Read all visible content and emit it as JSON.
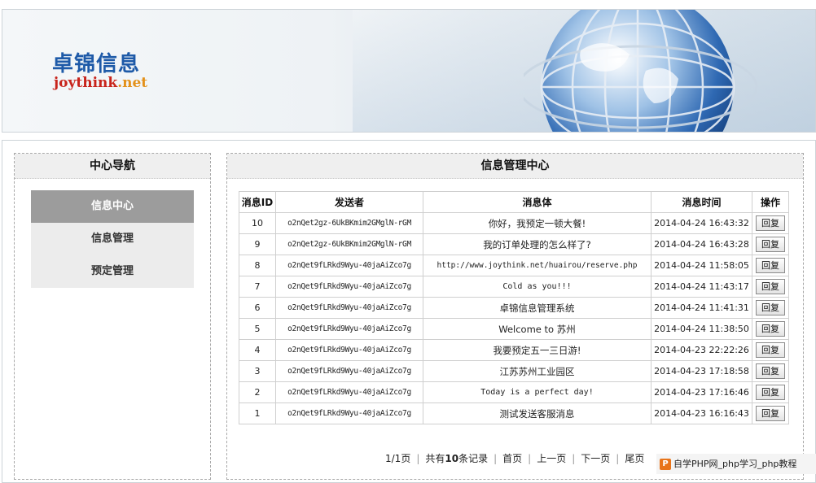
{
  "header": {
    "brand_cn": "卓锦信息",
    "brand_en_main": "joythink",
    "brand_en_tld": ".net"
  },
  "sidebar": {
    "title": "中心导航",
    "items": [
      {
        "label": "信息中心",
        "active": true
      },
      {
        "label": "信息管理",
        "active": false
      },
      {
        "label": "预定管理",
        "active": false
      }
    ]
  },
  "main": {
    "title": "信息管理中心",
    "columns": [
      "消息ID",
      "发送者",
      "消息体",
      "消息时间",
      "操作"
    ],
    "reply_label": "回复",
    "rows": [
      {
        "id": "10",
        "sender": "o2nQet2gz-6UkBKmim2GMglN-rGM",
        "body": "你好，我预定一顿大餐!",
        "time": "2014-04-24 16:43:32"
      },
      {
        "id": "9",
        "sender": "o2nQet2gz-6UkBKmim2GMglN-rGM",
        "body": "我的订单处理的怎么样了?",
        "time": "2014-04-24 16:43:28"
      },
      {
        "id": "8",
        "sender": "o2nQet9fLRkd9Wyu-40jaAiZco7g",
        "body": "http://www.joythink.net/huairou/reserve.php",
        "time": "2014-04-24 11:58:05"
      },
      {
        "id": "7",
        "sender": "o2nQet9fLRkd9Wyu-40jaAiZco7g",
        "body": "Cold as you!!!",
        "time": "2014-04-24 11:43:17"
      },
      {
        "id": "6",
        "sender": "o2nQet9fLRkd9Wyu-40jaAiZco7g",
        "body": "卓锦信息管理系统",
        "time": "2014-04-24 11:41:31"
      },
      {
        "id": "5",
        "sender": "o2nQet9fLRkd9Wyu-40jaAiZco7g",
        "body": "Welcome to 苏州",
        "time": "2014-04-24 11:38:50"
      },
      {
        "id": "4",
        "sender": "o2nQet9fLRkd9Wyu-40jaAiZco7g",
        "body": "我要预定五一三日游!",
        "time": "2014-04-23 22:22:26"
      },
      {
        "id": "3",
        "sender": "o2nQet9fLRkd9Wyu-40jaAiZco7g",
        "body": "江苏苏州工业园区",
        "time": "2014-04-23 17:18:58"
      },
      {
        "id": "2",
        "sender": "o2nQet9fLRkd9Wyu-40jaAiZco7g",
        "body": "Today is a perfect day!",
        "time": "2014-04-23 17:16:46"
      },
      {
        "id": "1",
        "sender": "o2nQet9fLRkd9Wyu-40jaAiZco7g",
        "body": "测试发送客服消息",
        "time": "2014-04-23 16:16:43"
      }
    ]
  },
  "pager": {
    "page_info": "1/1页",
    "total_prefix": "共有",
    "total_count": "10",
    "total_suffix": "条记录",
    "first": "首页",
    "prev": "上一页",
    "next": "下一页",
    "last": "尾页"
  },
  "watermark": {
    "logo": "P",
    "text": "自学PHP网_php学习_php教程"
  },
  "colors": {
    "brand_blue": "#1e5aa8",
    "brand_red": "#c8241c",
    "active_menu": "#9c9c9c",
    "menu_bg": "#ececec"
  }
}
